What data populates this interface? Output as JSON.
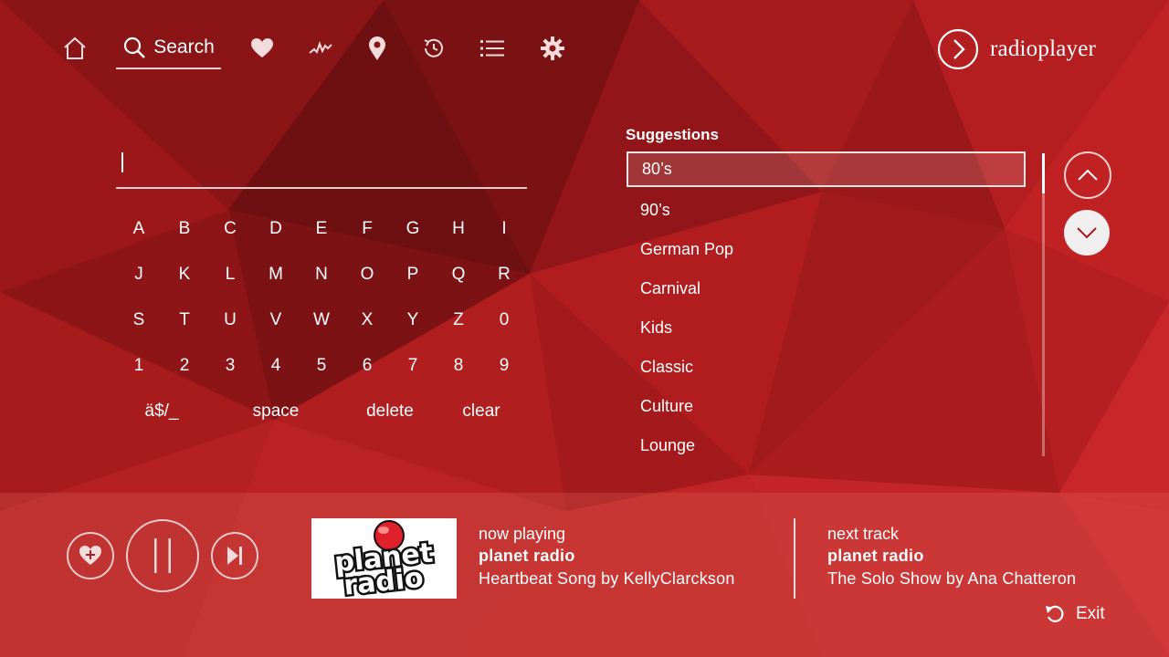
{
  "nav": {
    "items": [
      {
        "icon": "home-icon"
      },
      {
        "icon": "search-icon",
        "label": "Search",
        "active": true
      },
      {
        "icon": "heart-icon"
      },
      {
        "icon": "trending-icon"
      },
      {
        "icon": "location-pin-icon"
      },
      {
        "icon": "history-icon"
      },
      {
        "icon": "list-icon"
      },
      {
        "icon": "gear-icon"
      }
    ]
  },
  "brand": {
    "name": "radioplayer",
    "icon": "chevron-right-circle-icon"
  },
  "search": {
    "value": ""
  },
  "keyboard": {
    "rows": [
      [
        "A",
        "B",
        "C",
        "D",
        "E",
        "F",
        "G",
        "H",
        "I"
      ],
      [
        "J",
        "K",
        "L",
        "M",
        "N",
        "O",
        "P",
        "Q",
        "R"
      ],
      [
        "S",
        "T",
        "U",
        "V",
        "W",
        "X",
        "Y",
        "Z",
        "0"
      ],
      [
        "1",
        "2",
        "3",
        "4",
        "5",
        "6",
        "7",
        "8",
        "9"
      ]
    ],
    "special": {
      "symbols": "ä$/_",
      "space": "space",
      "delete": "delete",
      "clear": "clear"
    }
  },
  "suggestions": {
    "title": "Suggestions",
    "items": [
      "80’s",
      "90’s",
      "German Pop",
      "Carnival",
      "Kids",
      "Classic",
      "Culture",
      "Lounge"
    ],
    "selected_index": 0
  },
  "player": {
    "logo_text": [
      "planet",
      "radio"
    ],
    "now_playing": {
      "label": "now playing",
      "station": "planet radio",
      "track": "Heartbeat Song by KellyClarckson"
    },
    "next_track": {
      "label": "next track",
      "station": "planet radio",
      "track": "The Solo Show by Ana Chatteron"
    },
    "exit_label": "Exit"
  },
  "colors": {
    "background": "#a51a1c",
    "accent": "#ffffff",
    "logo_red": "#e0202a"
  }
}
